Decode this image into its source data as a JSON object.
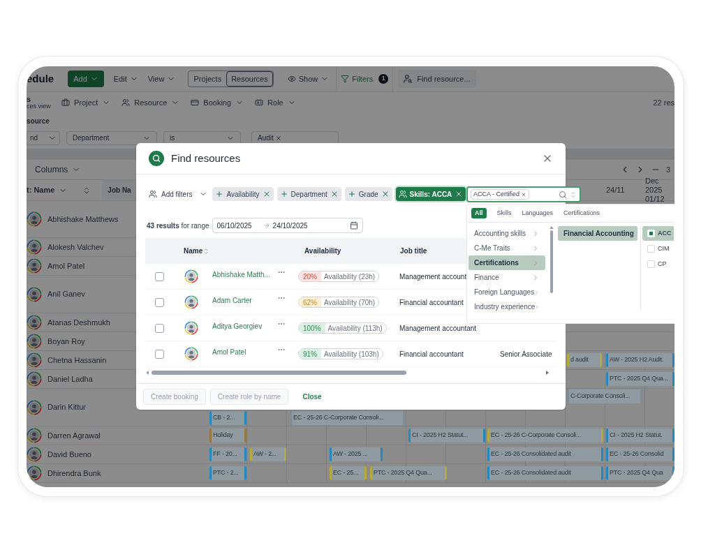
{
  "app": {
    "title": "edule",
    "toolbar": [
      {
        "kind": "primary",
        "label": "Add"
      },
      {
        "kind": "menu",
        "label": "Edit"
      },
      {
        "kind": "menu",
        "label": "View"
      }
    ],
    "view_toggle": [
      {
        "label": "Projects",
        "selected": false
      },
      {
        "label": "Resources",
        "selected": true
      }
    ],
    "show_menu": "Show",
    "filters": {
      "label": "Filters",
      "count": "1"
    },
    "find_button": "Find resource...",
    "view_info": {
      "line_1": "s",
      "line_2": "ces view"
    },
    "group_menus": [
      {
        "kind": "project",
        "label": "Project"
      },
      {
        "kind": "resource",
        "label": "Resource"
      },
      {
        "kind": "booking",
        "label": "Booking"
      },
      {
        "kind": "role",
        "label": "Role"
      }
    ],
    "results_count": "22 res",
    "filter_section": "source",
    "filter_row": {
      "operator": "nd",
      "field": "Department",
      "condition": "is",
      "values": [
        "Audit"
      ]
    },
    "columns_button": "Columns",
    "timeline_range": "3",
    "sort_label": "t: Name",
    "job_column": "Job Na",
    "dates": [
      {
        "day": "24/11"
      },
      {
        "month": "Dec 2025",
        "day": "01/12"
      }
    ],
    "resources": [
      {
        "name": "Abhishake Matthews"
      },
      {
        "name": "Alokesh Valchev"
      },
      {
        "name": "Amol Patel"
      },
      {
        "name": "Anil Ganev"
      },
      {
        "name": "Atanas Deshmukh"
      },
      {
        "name": "Boyan Roy"
      },
      {
        "name": "Chetna Hassanin",
        "bookings": [
          {
            "label": "d audit",
            "color": "#b5ab3c"
          },
          {
            "label": "AW - 2025 H2 Audit.",
            "color": "#2687bd"
          }
        ]
      },
      {
        "name": "Daniel Ladha",
        "bookings": [
          {
            "label": "PTC - 2025 Q4 Qua...",
            "color": "#2687bd"
          }
        ]
      },
      {
        "name": "Darin Kittur",
        "bookings": [
          {
            "label": "C-Corporate Consoli...",
            "color": "#7d8d99"
          },
          {
            "label": "CB - 2...",
            "color": "#2687bd"
          },
          {
            "label": "EC - 25-26 C-Corporate Consoli...",
            "color": "#7d8d99"
          }
        ]
      },
      {
        "name": "Darren Agrawal",
        "bookings": [
          {
            "label": "Holiday",
            "color": "#9a763f"
          },
          {
            "label": "CI - 2025 H2 Statut...",
            "color": "#2687bd"
          },
          {
            "label": "EC - 25-26 C-Corporate Consoli...",
            "color": "#b5ab3c"
          },
          {
            "label": "CI - 2025 H2 Statut.",
            "color": "#2687bd"
          }
        ]
      },
      {
        "name": "David Bueno",
        "bookings": [
          {
            "label": "FF - 20...",
            "color": "#2687bd"
          },
          {
            "label": "AW - 2...",
            "color": "#b5ab3c"
          },
          {
            "label": "AW - 2025 ...",
            "color": "#2687bd"
          },
          {
            "label": "EC - 25-26 Consolidated audit",
            "color": "#2687bd"
          },
          {
            "label": "EC - 25-26 Consolid",
            "color": "#2687bd"
          }
        ]
      },
      {
        "name": "Dhirendra Bunk",
        "bookings": [
          {
            "label": "PTC - 2...",
            "color": "#2687bd"
          },
          {
            "label": "EC - 25...",
            "color": "#b5ab3c"
          },
          {
            "label": "PTC - 2025 Q4 Qua...",
            "color": "#b5ab3c"
          },
          {
            "label": "EC - 25-26 Consolidated audit",
            "color": "#2687bd"
          },
          {
            "label": "PTC - 2025 Q4 Qua",
            "color": "#2687bd"
          }
        ]
      }
    ]
  },
  "modal": {
    "title": "Find resources",
    "add_filters": "Add filters",
    "filters": [
      {
        "kind": "option",
        "label": "Availability"
      },
      {
        "kind": "option",
        "label": "Department"
      },
      {
        "kind": "option",
        "label": "Grade"
      },
      {
        "kind": "applied",
        "label": "Skills: ACCA"
      }
    ],
    "results": "**43 results** for range",
    "date_from": "06/10/2025",
    "date_to": "24/10/2025",
    "columns": [
      "Name",
      "Availability",
      "Job title"
    ],
    "rows": [
      {
        "selected": false,
        "name": "Abhishake Matth...",
        "percent": "20%",
        "kind": "low",
        "availability": "Availability (23h)",
        "job_title": "Management account"
      },
      {
        "selected": false,
        "name": "Adam Carter",
        "percent": "62%",
        "kind": "partial",
        "availability": "Availability (70h)",
        "job_title": "Financial accountant"
      },
      {
        "selected": false,
        "name": "Aditya Georgiev",
        "percent": "100%",
        "kind": "full",
        "availability": "Availability (113h)",
        "job_title": "Management accountant"
      },
      {
        "selected": false,
        "name": "Amol Patel",
        "percent": "91%",
        "kind": "full",
        "availability": "Availability (103h)",
        "job_title": "Financial accountant",
        "grade": "Senior Associate"
      }
    ],
    "actions": [
      {
        "kind": "button",
        "label": "Create booking",
        "disabled": true
      },
      {
        "kind": "button",
        "label": "Create role by name",
        "disabled": true
      },
      {
        "kind": "link",
        "label": "Close",
        "disabled": false
      }
    ]
  },
  "skill_picker": {
    "tags": [
      "ACCA - Certified"
    ],
    "tabs": [
      {
        "label": "All",
        "selected": true
      },
      {
        "label": "Skills",
        "selected": false
      },
      {
        "label": "Languages",
        "selected": false
      },
      {
        "label": "Certifications",
        "selected": false
      }
    ],
    "categories": [
      {
        "label": "Accounting skills",
        "selected": false
      },
      {
        "label": "C-Me Traits",
        "selected": false
      },
      {
        "label": "Certifications",
        "selected": true
      },
      {
        "label": "Finance",
        "selected": false
      },
      {
        "label": "Foreign Languages",
        "selected": false
      },
      {
        "label": "Industry experience",
        "selected": false
      }
    ],
    "subcategories": [
      {
        "label": "Financial Accounting",
        "selected": true
      }
    ],
    "options": [
      {
        "label": "ACC",
        "checked": true
      },
      {
        "label": "CIM",
        "checked": false
      },
      {
        "label": "CP",
        "checked": false
      }
    ]
  }
}
